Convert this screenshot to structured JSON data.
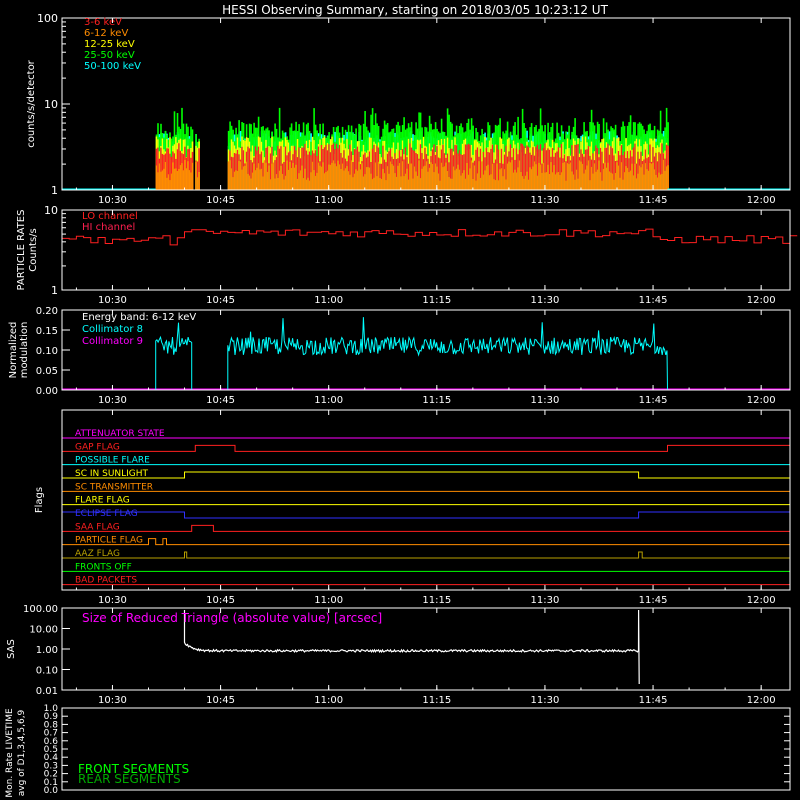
{
  "title": "HESSI Observing Summary, starting on 2018/03/05 10:23:12 UT",
  "colors": {
    "background": "#000000",
    "axes": "#ffffff",
    "e3_6": "#ff2020",
    "e6_12": "#ff8c00",
    "e12_25": "#ffff00",
    "e25_50": "#00ff00",
    "e50_100": "#00ffff",
    "particle_lo": "#ff2020",
    "particle_hi": "#ff2050",
    "collimator8": "#00ffff",
    "collimator9": "#ff00ff",
    "front_segments": "#00ff00",
    "rear_segments": "#00aa00"
  },
  "chart_data": [
    {
      "id": "count_rates",
      "type": "bar",
      "ylabel": "counts/s/detector",
      "yscale": "log",
      "ylim": [
        1,
        100
      ],
      "ytick_labels": [
        "1",
        "10",
        "100"
      ],
      "xlim": [
        "10:23",
        "12:04"
      ],
      "xtick_labels": [
        "10:30",
        "10:45",
        "11:00",
        "11:15",
        "11:30",
        "11:45",
        "12:00"
      ],
      "legend_position": "top-left",
      "series": [
        {
          "name": "3-6 keV",
          "color_key": "e3_6"
        },
        {
          "name": "6-12 keV",
          "color_key": "e6_12"
        },
        {
          "name": "12-25 keV",
          "color_key": "e12_25"
        },
        {
          "name": "25-50 keV",
          "color_key": "e25_50"
        },
        {
          "name": "50-100 keV",
          "color_key": "e50_100"
        }
      ],
      "observing_intervals": [
        [
          "10:36",
          "10:41"
        ],
        [
          "10:41.5",
          "10:42"
        ],
        [
          "10:46",
          "11:47"
        ]
      ],
      "approx_levels": {
        "e6_12": 1.6,
        "e3_6": 2.5,
        "e12_25": 3.0,
        "e25_50": 4.5,
        "e50_100": 3.5
      }
    },
    {
      "id": "particle_rates",
      "type": "line",
      "ylabel": "PARTICLE RATES",
      "ylabel2": "Counts/s",
      "yscale": "log",
      "ylim": [
        1,
        10
      ],
      "ytick_labels": [
        "1",
        "10"
      ],
      "xtick_labels": [
        "10:30",
        "10:45",
        "11:00",
        "11:15",
        "11:30",
        "11:45",
        "12:00"
      ],
      "series": [
        {
          "name": "LO channel",
          "color_key": "particle_lo"
        },
        {
          "name": "HI channel",
          "color_key": "particle_hi"
        }
      ],
      "typical_value": 4.5
    },
    {
      "id": "modulation",
      "type": "line",
      "ylabel": "Normalized",
      "ylabel2": "modulation",
      "ylim": [
        0,
        0.2
      ],
      "ytick_labels": [
        "0.00",
        "0.05",
        "0.10",
        "0.15",
        "0.20"
      ],
      "xtick_labels": [
        "10:30",
        "10:45",
        "11:00",
        "11:15",
        "11:30",
        "11:45",
        "12:00"
      ],
      "annotation": "Energy band: 6-12 keV",
      "series": [
        {
          "name": "Collimator 8",
          "color_key": "collimator8"
        },
        {
          "name": "Collimator 9",
          "color_key": "collimator9"
        }
      ],
      "typical_value": 0.11
    },
    {
      "id": "flags",
      "type": "line",
      "ylabel": "Flags",
      "xtick_labels": [
        "10:30",
        "10:45",
        "11:00",
        "11:15",
        "11:30",
        "11:45",
        "12:00"
      ],
      "flags": [
        {
          "name": "ATTENUATOR STATE",
          "color": "#ff00ff",
          "high": []
        },
        {
          "name": "GAP FLAG",
          "color": "#ff2020",
          "high": [
            [
              "10:41.5",
              "10:47"
            ],
            [
              "11:47",
              "12:04"
            ]
          ]
        },
        {
          "name": "POSSIBLE FLARE",
          "color": "#00ffff",
          "high": []
        },
        {
          "name": "SC IN SUNLIGHT",
          "color": "#ffff00",
          "high": [
            [
              "10:40",
              "11:43"
            ]
          ]
        },
        {
          "name": "SC TRANSMITTER",
          "color": "#ff8c00",
          "high": []
        },
        {
          "name": "FLARE FLAG",
          "color": "#ffff00",
          "high": []
        },
        {
          "name": "ECLIPSE FLAG",
          "color": "#3030ff",
          "high": [
            [
              "10:23",
              "10:40"
            ],
            [
              "11:43",
              "12:04"
            ]
          ]
        },
        {
          "name": "SAA FLAG",
          "color": "#ff2020",
          "high": [
            [
              "10:41",
              "10:44"
            ]
          ]
        },
        {
          "name": "PARTICLE FLAG",
          "color": "#ff8c00",
          "high": [
            [
              "10:35",
              "10:36"
            ],
            [
              "10:37",
              "10:37.5"
            ]
          ]
        },
        {
          "name": "AAZ FLAG",
          "color": "#b8a000",
          "high": [
            [
              "10:40",
              "10:40.3"
            ],
            [
              "11:43",
              "11:43.5"
            ]
          ]
        },
        {
          "name": "FRONTS OFF",
          "color": "#00ff00",
          "high": []
        },
        {
          "name": "BAD PACKETS",
          "color": "#ff2020",
          "high": []
        }
      ]
    },
    {
      "id": "sas",
      "type": "line",
      "ylabel": "SAS",
      "yscale": "log",
      "ylim": [
        0.01,
        100
      ],
      "ytick_labels": [
        "0.01",
        "0.10",
        "1.00",
        "10.00",
        "100.00"
      ],
      "xtick_labels": [
        "10:30",
        "10:45",
        "11:00",
        "11:15",
        "11:30",
        "11:45",
        "12:00"
      ],
      "annotation": "Size of Reduced Triangle (absolute value) [arcsec]",
      "active_interval": [
        "10:40",
        "11:43"
      ],
      "typical_value": 0.8
    },
    {
      "id": "livetime",
      "type": "line",
      "ylabel": "Mon. Rate LIVETIME",
      "ylabel2": "avg of D1,3,4,5,6,9",
      "ylim": [
        0,
        1
      ],
      "ytick_labels": [
        "0.0",
        "0.1",
        "0.2",
        "0.3",
        "0.4",
        "0.5",
        "0.6",
        "0.7",
        "0.8",
        "0.9",
        "1.0"
      ],
      "series": [
        {
          "name": "FRONT SEGMENTS",
          "color_key": "front_segments"
        },
        {
          "name": "REAR SEGMENTS",
          "color_key": "rear_segments"
        }
      ]
    }
  ]
}
